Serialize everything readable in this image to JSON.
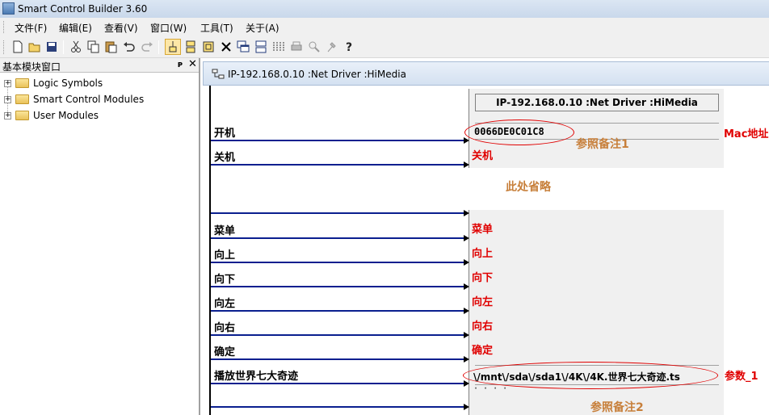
{
  "window": {
    "title": "Smart Control Builder 3.60"
  },
  "menu": [
    "文件(F)",
    "编辑(E)",
    "查看(V)",
    "窗口(W)",
    "工具(T)",
    "关于(A)"
  ],
  "panel": {
    "title": "基本模块窗口",
    "pin": "ᴘ",
    "close": "✕",
    "items": [
      "Logic Symbols",
      "Smart Control Modules",
      "User Modules"
    ]
  },
  "document": {
    "title": "IP-192.168.0.10 :Net Driver :HiMedia"
  },
  "block": {
    "header": "IP-192.168.0.10 :Net Driver :HiMedia",
    "mac_value": "0066DE0C01C8",
    "param_value": "\\/mnt\\/sda\\/sda1\\/4K\\/4K.世界七大奇迹.ts"
  },
  "inputs": [
    "开机",
    "关机",
    "菜单",
    "向上",
    "向下",
    "向左",
    "向右",
    "确定",
    "播放世界七大奇迹"
  ],
  "outputs": [
    "关机",
    "菜单",
    "向上",
    "向下",
    "向左",
    "向右",
    "确定"
  ],
  "annotations": {
    "mac_label": "Mac地址",
    "note1": "参照备注1",
    "omitted": "此处省略",
    "param_label": "参数_1",
    "note2": "参照备注2"
  },
  "colors": {
    "wire": "#0a1f8f",
    "annotation_red": "#e00000",
    "note_brown": "#c77f3a"
  }
}
